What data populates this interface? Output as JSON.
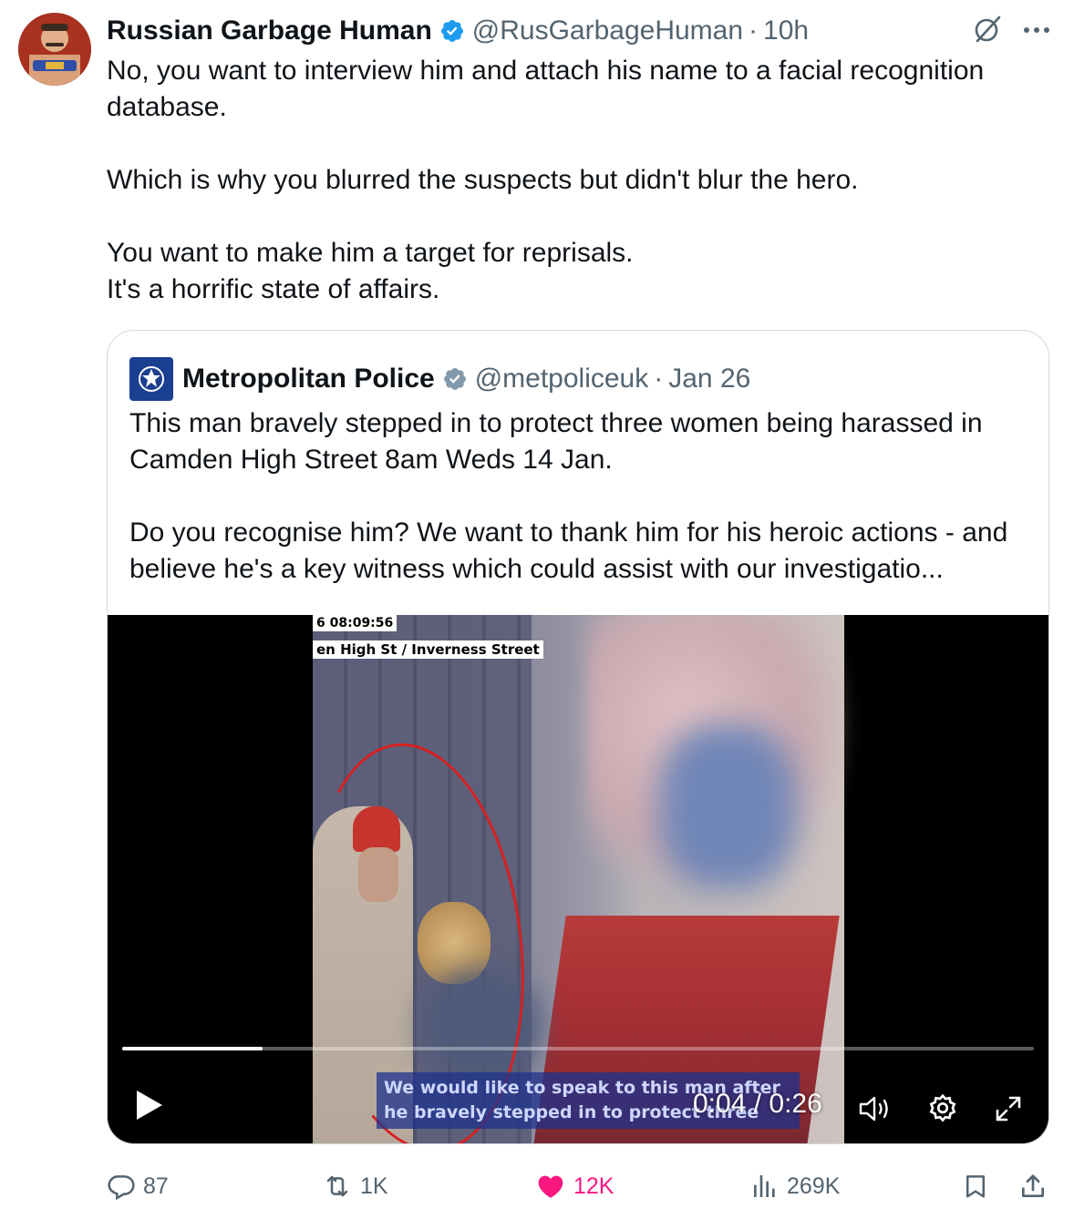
{
  "tweet": {
    "author_name": "Russian Garbage Human",
    "handle": "@RusGarbageHuman",
    "separator": "·",
    "time": "10h",
    "paragraphs": [
      "No, you want to interview him and attach his name to a facial recognition database.",
      "Which is why you blurred the suspects but didn't blur the hero.",
      "You want to make him a target for reprisals.",
      "It's a horrific state of affairs."
    ]
  },
  "quote": {
    "author_name": "Metropolitan Police",
    "handle": "@metpoliceuk",
    "separator": "·",
    "date": "Jan 26",
    "paragraphs": [
      "This man bravely stepped in to protect three women being harassed in Camden High Street 8am Weds 14 Jan.",
      "Do you recognise him? We want to thank him for his heroic actions - and believe he's a key witness which could assist with our investigatio..."
    ],
    "video": {
      "cctv_timestamp": "6 08:09:56",
      "cctv_location": "en High St  /  Inverness Street",
      "subtitle_line1": "We would like to speak to this man after",
      "subtitle_line2": "he bravely stepped in to protect three",
      "time_display": "0:04 / 0:26",
      "progress_fraction": 0.1538
    }
  },
  "actions": {
    "replies": "87",
    "reposts": "1K",
    "likes": "12K",
    "views": "269K"
  },
  "colors": {
    "text": "#0f1419",
    "secondary": "#536471",
    "verified": "#1d9bf0",
    "like": "#f91880",
    "border": "#cfd9de"
  },
  "icons": [
    "verified-badge-icon",
    "grok-icon",
    "more-icon",
    "reply-icon",
    "repost-icon",
    "like-icon",
    "views-icon",
    "bookmark-icon",
    "share-icon",
    "play-icon",
    "volume-icon",
    "settings-icon",
    "fullscreen-icon"
  ]
}
